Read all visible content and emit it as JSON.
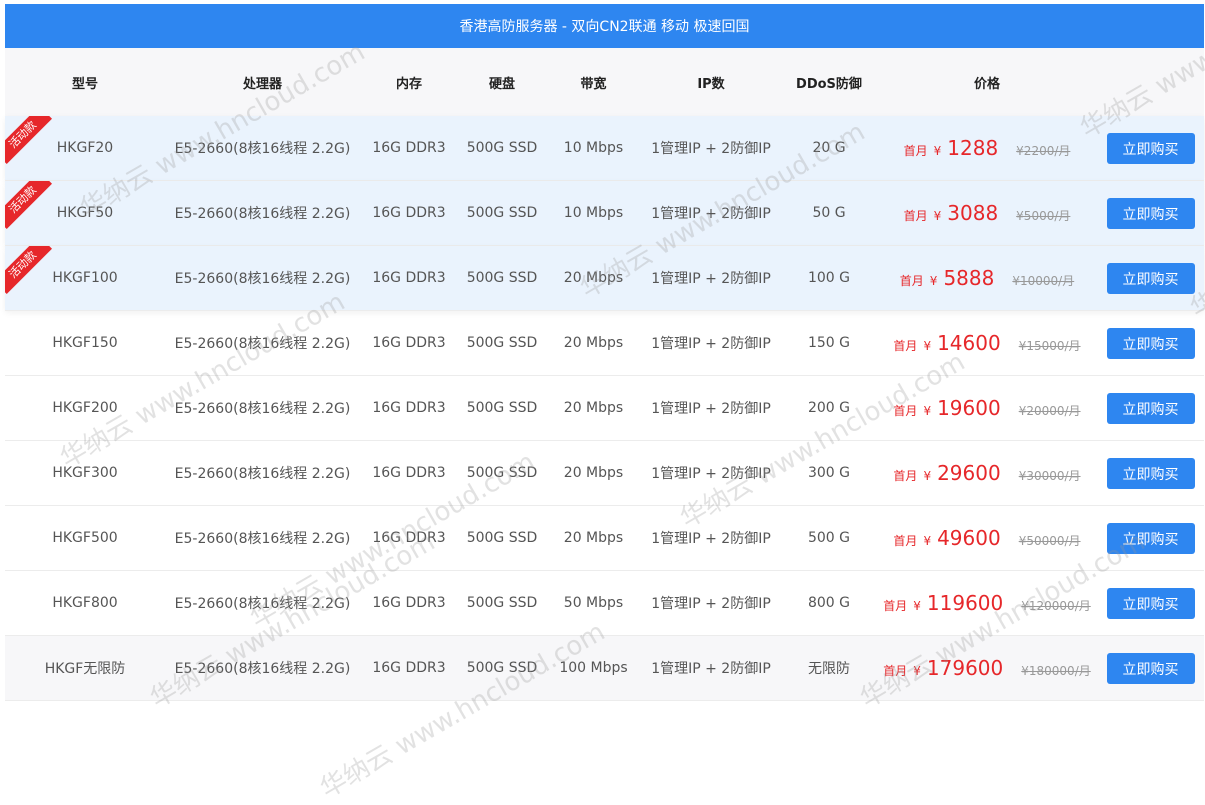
{
  "banner": {
    "title": "香港高防服务器 - 双向CN2联通 移动 极速回国"
  },
  "headers": {
    "model": "型号",
    "cpu": "处理器",
    "memory": "内存",
    "disk": "硬盘",
    "bandwidth": "带宽",
    "ip": "IP数",
    "ddos": "DDoS防御",
    "price": "价格"
  },
  "promo_badge": "活动款",
  "first_month_label": "首月",
  "currency": "¥",
  "buy_label": "立即购买",
  "watermark": "华纳云 www.hncloud.com",
  "rows": [
    {
      "model": "HKGF20",
      "cpu": "E5-2660(8核16线程 2.2G)",
      "memory": "16G DDR3",
      "disk": "500G SSD",
      "bandwidth": "10 Mbps",
      "ip": "1管理IP + 2防御IP",
      "ddos": "20 G",
      "price": "1288",
      "original": "¥2200/月",
      "promo": true
    },
    {
      "model": "HKGF50",
      "cpu": "E5-2660(8核16线程 2.2G)",
      "memory": "16G DDR3",
      "disk": "500G SSD",
      "bandwidth": "10 Mbps",
      "ip": "1管理IP + 2防御IP",
      "ddos": "50 G",
      "price": "3088",
      "original": "¥5000/月",
      "promo": true
    },
    {
      "model": "HKGF100",
      "cpu": "E5-2660(8核16线程 2.2G)",
      "memory": "16G DDR3",
      "disk": "500G SSD",
      "bandwidth": "20 Mbps",
      "ip": "1管理IP + 2防御IP",
      "ddos": "100 G",
      "price": "5888",
      "original": "¥10000/月",
      "promo": true
    },
    {
      "model": "HKGF150",
      "cpu": "E5-2660(8核16线程 2.2G)",
      "memory": "16G DDR3",
      "disk": "500G SSD",
      "bandwidth": "20 Mbps",
      "ip": "1管理IP + 2防御IP",
      "ddos": "150 G",
      "price": "14600",
      "original": "¥15000/月",
      "promo": false
    },
    {
      "model": "HKGF200",
      "cpu": "E5-2660(8核16线程 2.2G)",
      "memory": "16G DDR3",
      "disk": "500G SSD",
      "bandwidth": "20 Mbps",
      "ip": "1管理IP + 2防御IP",
      "ddos": "200 G",
      "price": "19600",
      "original": "¥20000/月",
      "promo": false
    },
    {
      "model": "HKGF300",
      "cpu": "E5-2660(8核16线程 2.2G)",
      "memory": "16G DDR3",
      "disk": "500G SSD",
      "bandwidth": "20 Mbps",
      "ip": "1管理IP + 2防御IP",
      "ddos": "300 G",
      "price": "29600",
      "original": "¥30000/月",
      "promo": false
    },
    {
      "model": "HKGF500",
      "cpu": "E5-2660(8核16线程 2.2G)",
      "memory": "16G DDR3",
      "disk": "500G SSD",
      "bandwidth": "20 Mbps",
      "ip": "1管理IP + 2防御IP",
      "ddos": "500 G",
      "price": "49600",
      "original": "¥50000/月",
      "promo": false
    },
    {
      "model": "HKGF800",
      "cpu": "E5-2660(8核16线程 2.2G)",
      "memory": "16G DDR3",
      "disk": "500G SSD",
      "bandwidth": "50 Mbps",
      "ip": "1管理IP + 2防御IP",
      "ddos": "800 G",
      "price": "119600",
      "original": "¥120000/月",
      "promo": false
    },
    {
      "model": "HKGF无限防",
      "cpu": "E5-2660(8核16线程 2.2G)",
      "memory": "16G DDR3",
      "disk": "500G SSD",
      "bandwidth": "100 Mbps",
      "ip": "1管理IP + 2防御IP",
      "ddos": "无限防",
      "price": "179600",
      "original": "¥180000/月",
      "promo": false
    }
  ]
}
